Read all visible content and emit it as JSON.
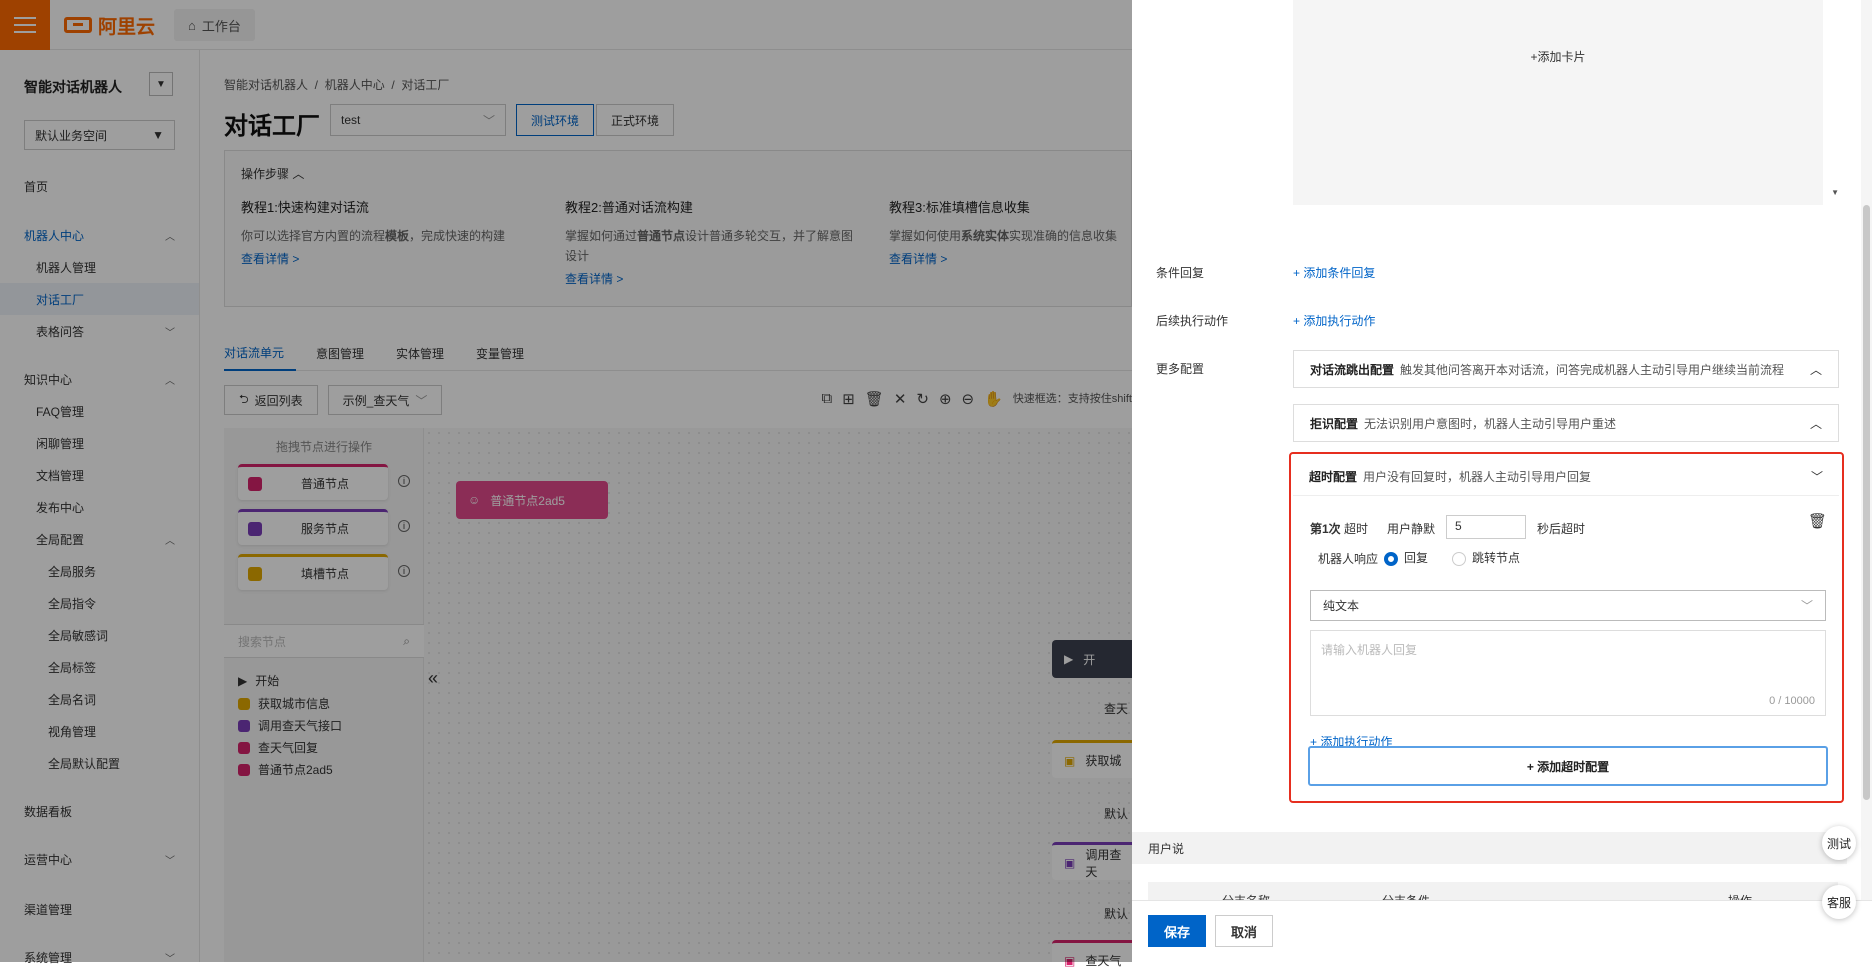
{
  "topbar": {
    "logo_text": "阿里云",
    "workbench": "工作台"
  },
  "sidebar": {
    "title": "智能对话机器人",
    "workspace": "默认业务空间",
    "items": [
      {
        "label": "首页"
      },
      {
        "label": "机器人中心"
      },
      {
        "label": "机器人管理"
      },
      {
        "label": "对话工厂"
      },
      {
        "label": "表格问答"
      },
      {
        "label": "知识中心"
      },
      {
        "label": "FAQ管理"
      },
      {
        "label": "闲聊管理"
      },
      {
        "label": "文档管理"
      },
      {
        "label": "发布中心"
      },
      {
        "label": "全局配置"
      },
      {
        "label": "全局服务"
      },
      {
        "label": "全局指令"
      },
      {
        "label": "全局敏感词"
      },
      {
        "label": "全局标签"
      },
      {
        "label": "全局名词"
      },
      {
        "label": "视角管理"
      },
      {
        "label": "全局默认配置"
      },
      {
        "label": "数据看板"
      },
      {
        "label": "运营中心"
      },
      {
        "label": "渠道管理"
      },
      {
        "label": "系统管理"
      }
    ]
  },
  "main": {
    "breadcrumb": [
      "智能对话机器人",
      "机器人中心",
      "对话工厂"
    ],
    "title": "对话工厂",
    "env_select": "test",
    "env_test": "测试环境",
    "env_prod": "正式环境",
    "steps_header": "操作步骤",
    "tutorials": [
      {
        "title": "教程1:快速构建对话流",
        "desc_pre": "你可以选择官方内置的流程",
        "desc_bold": "模板",
        "desc_post": "，完成快速的构建",
        "link": "查看详情 >"
      },
      {
        "title": "教程2:普通对话流构建",
        "desc_pre": "掌握如何通过",
        "desc_bold": "普通节点",
        "desc_post": "设计普通多轮交互，并了解意图设计",
        "link": "查看详情 >"
      },
      {
        "title": "教程3:标准填槽信息收集",
        "desc_pre": "掌握如何使用",
        "desc_bold": "系统实体",
        "desc_post": "实现准确的信息收集",
        "link": "查看详情 >"
      }
    ],
    "tabs": [
      "对话流单元",
      "意图管理",
      "实体管理",
      "变量管理"
    ],
    "back_btn": "返回列表",
    "flow_select": "示例_查天气",
    "quick_select": "快速框选：支持按住shift",
    "palette_header": "拖拽节点进行操作",
    "palette_nodes": [
      "普通节点",
      "服务节点",
      "填槽节点"
    ],
    "search_placeholder": "搜索节点",
    "tree": [
      "开始",
      "获取城市信息",
      "调用查天气接口",
      "查天气回复",
      "普通节点2ad5"
    ],
    "canvas_node": "普通节点2ad5",
    "canvas_labels": [
      "开",
      "查天",
      "获取城",
      "默认",
      "调用查天",
      "默认",
      "查天气"
    ]
  },
  "drawer": {
    "add_card": "+添加卡片",
    "cond_reply_label": "条件回复",
    "cond_reply_link": "+ 添加条件回复",
    "follow_action_label": "后续执行动作",
    "follow_action_link": "+ 添加执行动作",
    "more_config_label": "更多配置",
    "panel1_title": "对话流跳出配置",
    "panel1_desc": "触发其他问答离开本对话流，问答完成机器人主动引导用户继续当前流程",
    "panel2_title": "拒识配置",
    "panel2_desc": "无法识别用户意图时，机器人主动引导用户重述",
    "panel3_title": "超时配置",
    "panel3_desc": "用户没有回复时，机器人主动引导用户回复",
    "timeout_nth": "第1次",
    "timeout_word": "超时",
    "user_silent": "用户静默",
    "silent_value": "5",
    "seconds_after": "秒后超时",
    "bot_response": "机器人响应",
    "radio_reply": "回复",
    "radio_jump": "跳转节点",
    "reply_type": "纯文本",
    "reply_placeholder": "请输入机器人回复",
    "counter": "0 / 10000",
    "add_action": "+ 添加执行动作",
    "add_timeout": "+ 添加超时配置",
    "user_says": "用户说",
    "table_cols": [
      "分支名称",
      "分支条件",
      "操作"
    ],
    "save": "保存",
    "cancel": "取消",
    "float_test": "测试",
    "float_service": "客服"
  },
  "colors": {
    "brand": "#ff6a00",
    "primary": "#0064c8",
    "highlight": "#e62e1f",
    "node_pink": "#d6226b",
    "node_purple": "#7a3db8",
    "node_gold": "#e0a800"
  }
}
